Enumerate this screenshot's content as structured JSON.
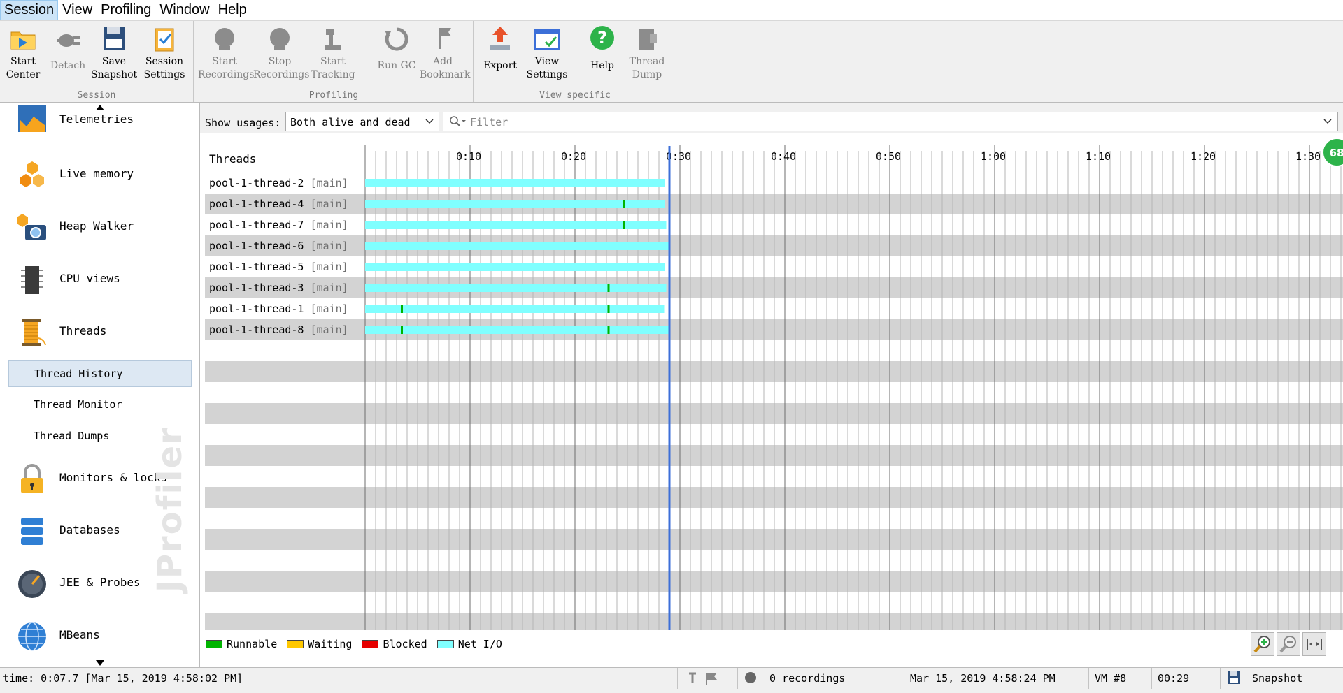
{
  "menu": [
    "Session",
    "View",
    "Profiling",
    "Window",
    "Help"
  ],
  "toolbar": {
    "groups": [
      {
        "name": "Session",
        "buttons": [
          {
            "line1": "Start",
            "line2": "Center",
            "icon": "folder-play-icon",
            "enabled": true
          },
          {
            "line1": "Detach",
            "line2": "",
            "icon": "plug-icon",
            "enabled": false
          },
          {
            "line1": "Save",
            "line2": "Snapshot",
            "icon": "floppy-disk-icon",
            "enabled": true
          },
          {
            "line1": "Session",
            "line2": "Settings",
            "icon": "clipboard-settings-icon",
            "enabled": true
          }
        ]
      },
      {
        "name": "Profiling",
        "buttons": [
          {
            "line1": "Start",
            "line2": "Recordings",
            "icon": "start-recording-icon",
            "enabled": false
          },
          {
            "line1": "Stop",
            "line2": "Recordings",
            "icon": "stop-recording-icon",
            "enabled": false
          },
          {
            "line1": "Start",
            "line2": "Tracking",
            "icon": "tracking-icon",
            "enabled": false
          },
          {
            "line1": "Run GC",
            "line2": "",
            "icon": "recycle-icon",
            "enabled": false
          },
          {
            "line1": "Add",
            "line2": "Bookmark",
            "icon": "bookmark-icon",
            "enabled": false
          }
        ]
      },
      {
        "name": "View specific",
        "buttons": [
          {
            "line1": "Export",
            "line2": "",
            "icon": "export-arrow-icon",
            "enabled": true
          },
          {
            "line1": "View",
            "line2": "Settings",
            "icon": "view-settings-icon",
            "enabled": true
          },
          {
            "line1": "Help",
            "line2": "",
            "icon": "help-icon",
            "enabled": true
          },
          {
            "line1": "Thread",
            "line2": "Dump",
            "icon": "thread-dump-icon",
            "enabled": false
          }
        ]
      }
    ]
  },
  "sidebar": {
    "items": [
      {
        "label": "Telemetries",
        "icon": "telemetries-icon"
      },
      {
        "label": "Live memory",
        "icon": "live-memory-icon"
      },
      {
        "label": "Heap Walker",
        "icon": "heap-walker-icon"
      },
      {
        "label": "CPU views",
        "icon": "cpu-chip-icon"
      },
      {
        "label": "Threads",
        "icon": "thread-spool-icon"
      }
    ],
    "subitems": [
      {
        "label": "Thread History",
        "selected": true
      },
      {
        "label": "Thread Monitor",
        "selected": false
      },
      {
        "label": "Thread Dumps",
        "selected": false
      }
    ],
    "items2": [
      {
        "label": "Monitors & locks",
        "icon": "padlock-icon"
      },
      {
        "label": "Databases",
        "icon": "database-icon"
      },
      {
        "label": "JEE & Probes",
        "icon": "gauge-icon"
      },
      {
        "label": "MBeans",
        "icon": "globe-icon"
      }
    ],
    "watermark": "JProfiler"
  },
  "filterbar": {
    "usage_label": "Show usages:",
    "usage_value": "Both alive and dead",
    "filter_placeholder": "Filter"
  },
  "timeline": {
    "header": "Threads",
    "ticks": [
      "0:10",
      "0:20",
      "0:30",
      "0:40",
      "0:50",
      "1:00",
      "1:10",
      "1:20",
      "1:30"
    ],
    "badge": "68",
    "current_time_sec": 29,
    "threads": [
      {
        "name": "pool-1-thread-2",
        "group": "[main]",
        "end_sec": 28.6,
        "runnable_marks_sec": []
      },
      {
        "name": "pool-1-thread-4",
        "group": "[main]",
        "end_sec": 28.6,
        "runnable_marks_sec": [
          24.7
        ]
      },
      {
        "name": "pool-1-thread-7",
        "group": "[main]",
        "end_sec": 28.7,
        "runnable_marks_sec": [
          24.7
        ]
      },
      {
        "name": "pool-1-thread-6",
        "group": "[main]",
        "end_sec": 28.9,
        "runnable_marks_sec": []
      },
      {
        "name": "pool-1-thread-5",
        "group": "[main]",
        "end_sec": 28.6,
        "runnable_marks_sec": []
      },
      {
        "name": "pool-1-thread-3",
        "group": "[main]",
        "end_sec": 28.7,
        "runnable_marks_sec": [
          23.2
        ]
      },
      {
        "name": "pool-1-thread-1",
        "group": "[main]",
        "end_sec": 28.5,
        "runnable_marks_sec": [
          3.5,
          23.2
        ]
      },
      {
        "name": "pool-1-thread-8",
        "group": "[main]",
        "end_sec": 28.9,
        "runnable_marks_sec": [
          3.5,
          23.2
        ]
      }
    ]
  },
  "legend": [
    {
      "label": "Runnable",
      "color": "#00b400"
    },
    {
      "label": "Waiting",
      "color": "#ffc800"
    },
    {
      "label": "Blocked",
      "color": "#e60000"
    },
    {
      "label": "Net I/O",
      "color": "#80ffff"
    }
  ],
  "colors": {
    "accent": "#3c6fd8",
    "netio": "#80ffff",
    "runnable": "#00b400",
    "badge": "#2db34a"
  },
  "status": {
    "time": "time: 0:07.7 [Mar 15, 2019 4:58:02 PM]",
    "recordings": "0 recordings",
    "datetime": "Mar 15, 2019 4:58:24 PM",
    "vm": "VM #8",
    "elapsed": "00:29",
    "snapshot": "Snapshot"
  }
}
